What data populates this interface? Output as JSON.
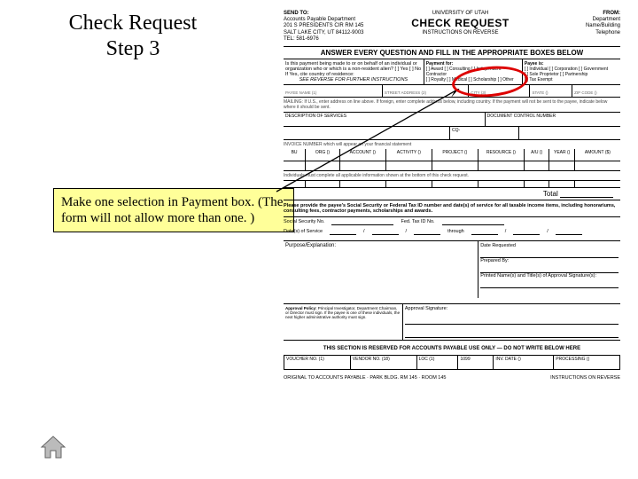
{
  "title_line1": "Check Request",
  "title_line2": "Step 3",
  "callout_text": "Make one selection in Payment box. (The form will not allow more than one. )",
  "form": {
    "sendto_label": "SEND TO:",
    "sendto_body": "Accounts Payable Department\n201 S PRESIDENTS CIR RM 145\nSALT LAKE CITY, UT 84112-9003\nTEL: 581-6976",
    "university_line": "UNIVERSITY OF UTAH",
    "mainTitle": "CHECK REQUEST",
    "subTitle": "INSTRUCTIONS ON REVERSE",
    "from_label": "FROM:",
    "from_body": "Department\nName/Building\nTelephone",
    "banner": "ANSWER EVERY QUESTION AND FILL IN THE APPROPRIATE BOXES BELOW",
    "qLeft_line1": "Is this payment being made to or on behalf of an individual or organization who or which is a non-resident alien? [ ] Yes [ ] No",
    "qLeft_line2": "If Yes, cite country of residence:",
    "qLeft_instr": "SEE REVERSE FOR FURTHER INSTRUCTIONS",
    "paymentFor_label": "Payment for:",
    "paymentOptions": "[ ] Award  [ ] Consulting  [ ] Independent Contractor\n[ ] Royalty [ ] Medical [ ] Scholarship [ ] Other",
    "payeeIs_label": "Payee is:",
    "payeeOptions": "[ ] Individual [ ] Corporation [ ] Government\n[ ] Sole Proprietor [ ] Partnership\n[ ] Tax Exempt",
    "payee_name": "PAYEE NAME (1)",
    "street": "STREET ADDRESS (2)",
    "city": "CITY (3)",
    "state": "STATE ()",
    "zip": "ZIP CODE ()",
    "mailing_note": "MAILING: If U.S., enter address on line above. If foreign, enter complete address below, including country. If the payment will not be sent to the payee, indicate below where it should be sent.",
    "docnum": "DESCRIPTION OF SERVICES",
    "doccontrol": "DOCUMENT CONTROL NUMBER",
    "co_prefix": "CQ-",
    "invoice_hint": "INVOICE NUMBER which will appear on your financial statement",
    "cols": {
      "bu": "BU",
      "org": "ORG ()",
      "acct": "ACCOUNT ()",
      "fund": "ACTIVITY ()",
      "proj": "PROJECT ()",
      "resource": "RESOURCE ()",
      "au": "A/U ()",
      "yr": "YEAR ()",
      "amount": "AMOUNT ($)"
    },
    "individuals_note": "Individuals must complete all applicable information shown at the bottom of this check request.",
    "totalLabel": "Total",
    "warn": "Please provide the payee's Social Security or Federal Tax ID number and date(s) of service for all taxable income items, including honorariums, consulting fees, contractor payments, scholarships and awards.",
    "ssn_label": "Social Security No.",
    "taxid_label": "Fed. Tax ID No.",
    "dos_label": "Date(s) of Service",
    "through": "through",
    "purpose_label": "Purpose/Explanation:",
    "date_req": "Date Requested",
    "prepared": "Prepared By:",
    "printed": "Printed Name(s) and Title(s) of Approval Signature(s):",
    "policy_label": "Approval Policy:",
    "policy_text": "Principal Investigator, Department Chairman, or Director must sign. If the payee is one of these individuals, the next higher administrative authority must sign.",
    "appsig": "Approval Signature:",
    "reserve": "THIS SECTION IS RESERVED FOR ACCOUNTS PAYABLE USE ONLY — DO NOT WRITE BELOW HERE",
    "ap": {
      "voucher": "VOUCHER NO. (1)",
      "vendor": "VENDOR NO. (18)",
      "loc": "LOC (1)",
      "ten99": "1099",
      "date": "INV. DATE ()",
      "dist": "PROCESSING ()"
    },
    "footer_left": "ORIGINAL TO ACCOUNTS PAYABLE · PARK BLDG. RM 145 · ROOM 145",
    "footer_right": "INSTRUCTIONS ON REVERSE"
  }
}
